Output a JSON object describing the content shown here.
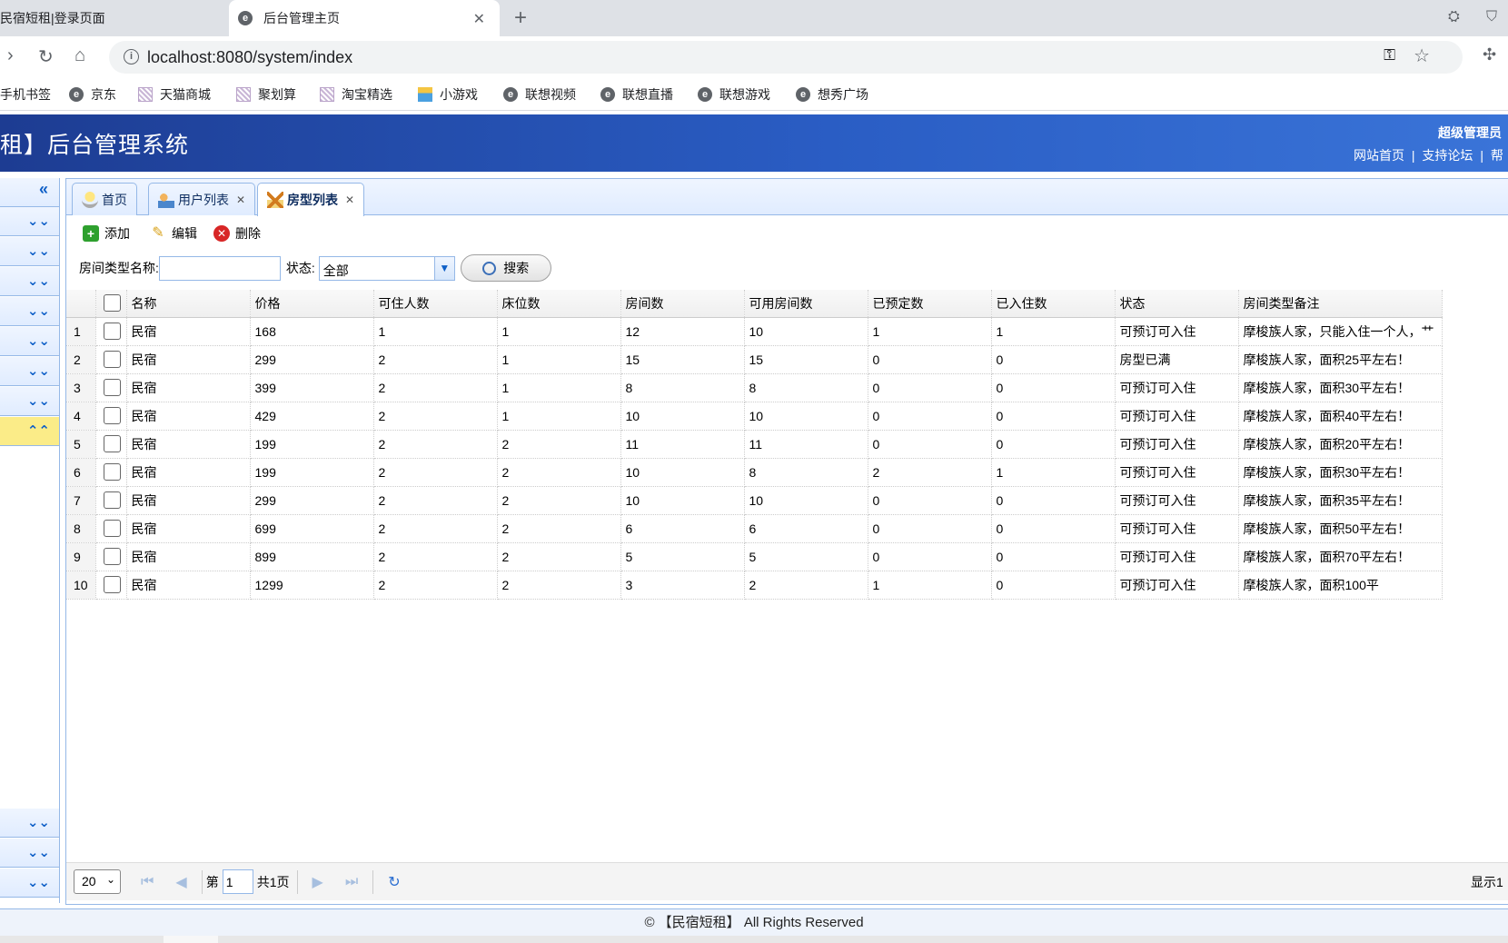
{
  "browser": {
    "tabs": [
      {
        "label": "民宿短租|登录页面",
        "active": false
      },
      {
        "label": "后台管理主页",
        "active": true
      }
    ],
    "url": "localhost:8080/system/index",
    "bookmarks": [
      {
        "label": "手机书签",
        "icon": "none"
      },
      {
        "label": "京东",
        "icon": "e-icon"
      },
      {
        "label": "天猫商城",
        "icon": "tmall-icon"
      },
      {
        "label": "聚划算",
        "icon": "tmall-icon"
      },
      {
        "label": "淘宝精选",
        "icon": "tmall-icon"
      },
      {
        "label": "小游戏",
        "icon": "game-icon"
      },
      {
        "label": "联想视频",
        "icon": "e-icon"
      },
      {
        "label": "联想直播",
        "icon": "e-icon"
      },
      {
        "label": "联想游戏",
        "icon": "e-icon"
      },
      {
        "label": "想秀广场",
        "icon": "e-icon"
      }
    ]
  },
  "header": {
    "title": "租】后台管理系统",
    "user": "超级管理员",
    "links": [
      "网站首页",
      "支持论坛",
      "帮"
    ]
  },
  "tabs": [
    {
      "label": "首页",
      "closable": false,
      "active": false,
      "icon": "bulb-icon"
    },
    {
      "label": "用户列表",
      "closable": true,
      "active": false,
      "icon": "users-icon"
    },
    {
      "label": "房型列表",
      "closable": true,
      "active": true,
      "icon": "house-icon"
    }
  ],
  "toolbar": {
    "add": "添加",
    "edit": "编辑",
    "delete": "删除"
  },
  "search": {
    "name_label": "房间类型名称:",
    "name_value": "",
    "status_label": "状态:",
    "status_value": "全部",
    "button": "搜索"
  },
  "grid": {
    "columns": [
      "名称",
      "价格",
      "可住人数",
      "床位数",
      "房间数",
      "可用房间数",
      "已预定数",
      "已入住数",
      "状态",
      "房间类型备注"
    ],
    "rows": [
      [
        "1",
        "民宿",
        "168",
        "1",
        "1",
        "12",
        "10",
        "1",
        "1",
        "可预订可入住",
        "摩梭族人家，只能入住一个人，艹"
      ],
      [
        "2",
        "民宿",
        "299",
        "2",
        "1",
        "15",
        "15",
        "0",
        "0",
        "房型已满",
        "摩梭族人家，面积25平左右！"
      ],
      [
        "3",
        "民宿",
        "399",
        "2",
        "1",
        "8",
        "8",
        "0",
        "0",
        "可预订可入住",
        "摩梭族人家，面积30平左右！"
      ],
      [
        "4",
        "民宿",
        "429",
        "2",
        "1",
        "10",
        "10",
        "0",
        "0",
        "可预订可入住",
        "摩梭族人家，面积40平左右！"
      ],
      [
        "5",
        "民宿",
        "199",
        "2",
        "2",
        "11",
        "11",
        "0",
        "0",
        "可预订可入住",
        "摩梭族人家，面积20平左右！"
      ],
      [
        "6",
        "民宿",
        "199",
        "2",
        "2",
        "10",
        "8",
        "2",
        "1",
        "可预订可入住",
        "摩梭族人家，面积30平左右！"
      ],
      [
        "7",
        "民宿",
        "299",
        "2",
        "2",
        "10",
        "10",
        "0",
        "0",
        "可预订可入住",
        "摩梭族人家，面积35平左右！"
      ],
      [
        "8",
        "民宿",
        "699",
        "2",
        "2",
        "6",
        "6",
        "0",
        "0",
        "可预订可入住",
        "摩梭族人家，面积50平左右！"
      ],
      [
        "9",
        "民宿",
        "899",
        "2",
        "2",
        "5",
        "5",
        "0",
        "0",
        "可预订可入住",
        "摩梭族人家，面积70平左右！"
      ],
      [
        "10",
        "民宿",
        "1299",
        "2",
        "2",
        "3",
        "2",
        "1",
        "0",
        "可预订可入住",
        "摩梭族人家，面积100平"
      ]
    ]
  },
  "pager": {
    "page_size": "20",
    "page_prefix": "第",
    "page_value": "1",
    "page_total": "共1页",
    "display": "显示1"
  },
  "footer": "© 【民宿短租】 All Rights Reserved"
}
